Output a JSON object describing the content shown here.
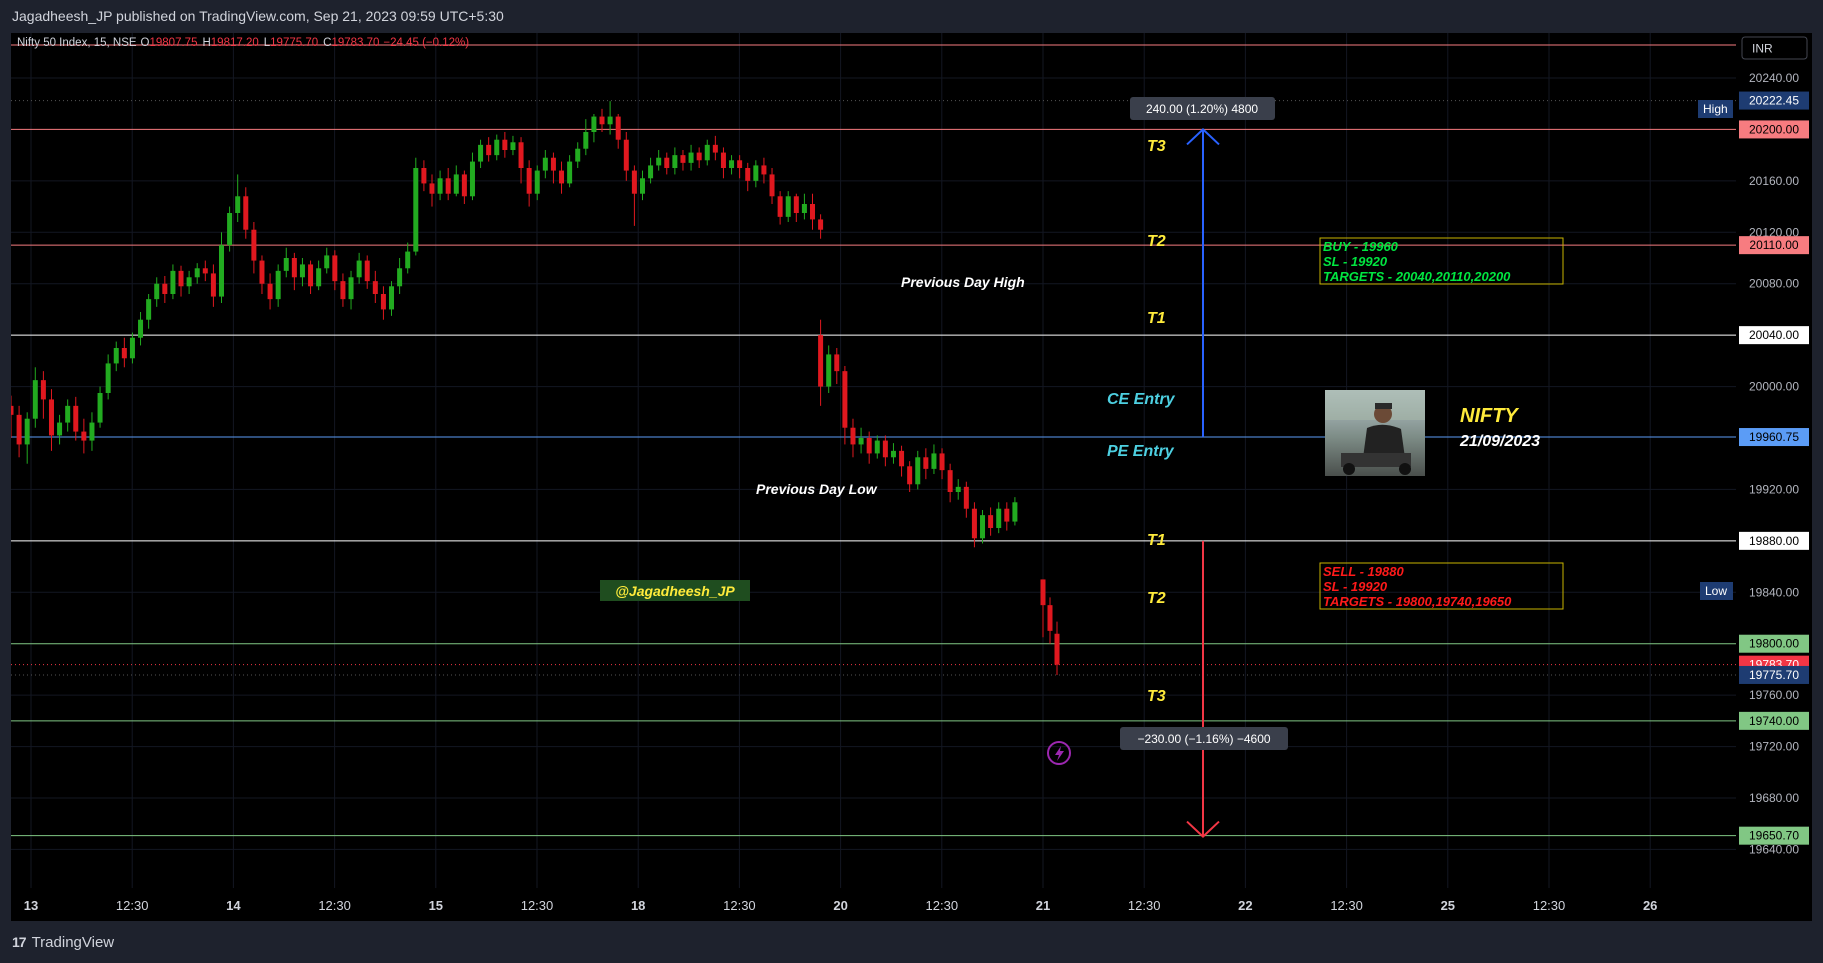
{
  "header": {
    "publish_line": "Jagadheesh_JP published on TradingView.com, Sep 21, 2023 09:59 UTC+5:30"
  },
  "footer": {
    "brand": "TradingView"
  },
  "legend": {
    "symbol": "Nifty 50 Index, 15, NSE",
    "o_label": "O",
    "o_value": "19807.75",
    "h_label": "H",
    "h_value": "19817.20",
    "l_label": "L",
    "l_value": "19775.70",
    "c_label": "C",
    "c_value": "19783.70",
    "change": "−24.45 (−0.12%)"
  },
  "currency": "INR",
  "colors": {
    "up": "#22ab20",
    "down": "#e0181f",
    "background": "#000000",
    "target_label": "#ffeb3b",
    "entry_label": "#4dd0e1"
  },
  "chart_data": {
    "type": "candlestick",
    "title": "Nifty 50 Index, 15, NSE",
    "ylim": [
      19610,
      20275
    ],
    "x_ticks": [
      "13",
      "12:30",
      "14",
      "12:30",
      "15",
      "12:30",
      "18",
      "12:30",
      "20",
      "12:30",
      "21",
      "12:30",
      "22",
      "12:30",
      "25",
      "12:30",
      "26"
    ],
    "y_ticks": [
      "20240.00",
      "20160.00",
      "20120.00",
      "20080.00",
      "20000.00",
      "19920.00",
      "19840.00",
      "19720.00",
      "19680.00",
      "19640.00",
      "19760.00"
    ],
    "levels": [
      {
        "label": "20200.00",
        "value": 20200.0,
        "color": "#f77c80"
      },
      {
        "label": "20110.00",
        "value": 20110.0,
        "color": "#f77c80"
      },
      {
        "label": "20040.00",
        "value": 20040.0,
        "color": "#ffffff"
      },
      {
        "label": "19960.75",
        "value": 19960.75,
        "color": "#5b9cf6"
      },
      {
        "label": "19880.00",
        "value": 19880.0,
        "color": "#ffffff"
      },
      {
        "label": "19800.00",
        "value": 19800.0,
        "color": "#81c784"
      },
      {
        "label": "19740.00",
        "value": 19740.0,
        "color": "#81c784"
      },
      {
        "label": "19650.70",
        "value": 19650.7,
        "color": "#81c784"
      }
    ],
    "high": {
      "label": "High",
      "value": "20222.45"
    },
    "low": {
      "label": "Low",
      "value": "19775.70"
    },
    "last": {
      "value": "19783.70"
    },
    "measures": {
      "up": {
        "text": "240.00 (1.20%) 4800",
        "from": 19960.75,
        "to": 20200.0
      },
      "down": {
        "text": "−230.00 (−1.16%) −4600",
        "from": 19880.0,
        "to": 19650.0
      }
    },
    "sessions": [
      {
        "label": "Sep 13",
        "candles": [
          [
            19985,
            19978,
            19960,
            19993
          ],
          [
            19978,
            19955,
            19945,
            19985
          ],
          [
            19955,
            19975,
            19940,
            19980
          ],
          [
            19975,
            20005,
            19968,
            20015
          ],
          [
            20005,
            19990,
            19975,
            20012
          ],
          [
            19990,
            19962,
            19950,
            19998
          ],
          [
            19962,
            19972,
            19955,
            19978
          ],
          [
            19972,
            19985,
            19965,
            19990
          ],
          [
            19985,
            19965,
            19958,
            19992
          ],
          [
            19965,
            19958,
            19948,
            19975
          ],
          [
            19958,
            19972,
            19950,
            19980
          ],
          [
            19972,
            19995,
            19968,
            20000
          ],
          [
            19995,
            20018,
            19990,
            20025
          ],
          [
            20018,
            20030,
            20012,
            20035
          ],
          [
            20030,
            20022,
            20015,
            20038
          ],
          [
            20022,
            20038,
            20018,
            20042
          ],
          [
            20038,
            20052,
            20032,
            20058
          ],
          [
            20052,
            20068,
            20045,
            20072
          ],
          [
            20068,
            20080,
            20062,
            20085
          ],
          [
            20080,
            20072,
            20065,
            20086
          ],
          [
            20072,
            20090,
            20068,
            20095
          ],
          [
            20090,
            20078,
            20070,
            20094
          ],
          [
            20078,
            20085,
            20072,
            20090
          ],
          [
            20085,
            20092,
            20080,
            20096
          ],
          [
            20092,
            20088,
            20082,
            20098
          ]
        ]
      },
      {
        "label": "Sep 14",
        "candles": [
          [
            20088,
            20070,
            20062,
            20095
          ],
          [
            20070,
            20110,
            20065,
            20120
          ],
          [
            20110,
            20135,
            20105,
            20140
          ],
          [
            20135,
            20148,
            20128,
            20165
          ],
          [
            20148,
            20122,
            20115,
            20155
          ],
          [
            20122,
            20098,
            20088,
            20128
          ],
          [
            20098,
            20080,
            20072,
            20102
          ],
          [
            20080,
            20068,
            20060,
            20088
          ],
          [
            20068,
            20090,
            20062,
            20095
          ],
          [
            20090,
            20100,
            20085,
            20108
          ],
          [
            20100,
            20085,
            20075,
            20104
          ],
          [
            20085,
            20095,
            20078,
            20100
          ],
          [
            20095,
            20078,
            20072,
            20098
          ],
          [
            20078,
            20092,
            20075,
            20098
          ],
          [
            20092,
            20102,
            20088,
            20108
          ],
          [
            20102,
            20082,
            20075,
            20106
          ],
          [
            20082,
            20068,
            20062,
            20088
          ],
          [
            20068,
            20085,
            20060,
            20090
          ],
          [
            20085,
            20098,
            20080,
            20104
          ],
          [
            20098,
            20082,
            20076,
            20102
          ],
          [
            20082,
            20072,
            20065,
            20090
          ],
          [
            20072,
            20060,
            20052,
            20078
          ],
          [
            20060,
            20078,
            20055,
            20082
          ],
          [
            20078,
            20092,
            20072,
            20100
          ],
          [
            20092,
            20105,
            20088,
            20112
          ]
        ]
      },
      {
        "label": "Sep 15",
        "candles": [
          [
            20105,
            20170,
            20102,
            20178
          ],
          [
            20170,
            20158,
            20152,
            20176
          ],
          [
            20158,
            20150,
            20140,
            20165
          ],
          [
            20150,
            20162,
            20145,
            20168
          ],
          [
            20162,
            20150,
            20145,
            20170
          ],
          [
            20150,
            20165,
            20148,
            20172
          ],
          [
            20165,
            20148,
            20142,
            20168
          ],
          [
            20148,
            20175,
            20145,
            20182
          ],
          [
            20175,
            20188,
            20170,
            20192
          ],
          [
            20188,
            20180,
            20175,
            20194
          ],
          [
            20180,
            20192,
            20176,
            20196
          ],
          [
            20192,
            20184,
            20178,
            20198
          ],
          [
            20184,
            20190,
            20180,
            20195
          ],
          [
            20190,
            20170,
            20158,
            20194
          ],
          [
            20170,
            20150,
            20140,
            20176
          ],
          [
            20150,
            20168,
            20145,
            20172
          ],
          [
            20168,
            20178,
            20162,
            20184
          ],
          [
            20178,
            20168,
            20158,
            20182
          ],
          [
            20168,
            20158,
            20150,
            20175
          ],
          [
            20158,
            20175,
            20155,
            20180
          ],
          [
            20175,
            20185,
            20170,
            20190
          ],
          [
            20185,
            20198,
            20180,
            20208
          ],
          [
            20198,
            20210,
            20190,
            20212
          ],
          [
            20210,
            20204,
            20198,
            20216
          ],
          [
            20204,
            20210,
            20196,
            20222
          ]
        ]
      },
      {
        "label": "Sep 18",
        "candles": [
          [
            20210,
            20192,
            20185,
            20212
          ],
          [
            20192,
            20168,
            20160,
            20198
          ],
          [
            20168,
            20150,
            20125,
            20172
          ],
          [
            20150,
            20162,
            20145,
            20168
          ],
          [
            20162,
            20172,
            20158,
            20178
          ],
          [
            20172,
            20178,
            20168,
            20184
          ],
          [
            20178,
            20170,
            20165,
            20182
          ],
          [
            20170,
            20180,
            20165,
            20186
          ],
          [
            20180,
            20174,
            20168,
            20184
          ],
          [
            20174,
            20182,
            20168,
            20188
          ],
          [
            20182,
            20176,
            20170,
            20186
          ],
          [
            20176,
            20188,
            20172,
            20192
          ],
          [
            20188,
            20182,
            20176,
            20195
          ],
          [
            20182,
            20170,
            20162,
            20186
          ],
          [
            20170,
            20176,
            20165,
            20180
          ],
          [
            20176,
            20170,
            20162,
            20180
          ],
          [
            20170,
            20160,
            20152,
            20174
          ],
          [
            20160,
            20172,
            20155,
            20176
          ],
          [
            20172,
            20165,
            20158,
            20178
          ],
          [
            20165,
            20148,
            20142,
            20170
          ],
          [
            20148,
            20132,
            20126,
            20152
          ],
          [
            20132,
            20148,
            20128,
            20152
          ],
          [
            20148,
            20135,
            20128,
            20150
          ],
          [
            20135,
            20142,
            20130,
            20150
          ],
          [
            20142,
            20130,
            20122,
            20150
          ],
          [
            20130,
            20122,
            20115,
            20134
          ]
        ]
      },
      {
        "label": "Sep 20",
        "candles": [
          [
            20040,
            20000,
            19985,
            20052
          ],
          [
            20000,
            20025,
            19995,
            20032
          ],
          [
            20025,
            20012,
            20002,
            20030
          ],
          [
            20012,
            19968,
            19955,
            20016
          ],
          [
            19968,
            19955,
            19945,
            19975
          ],
          [
            19955,
            19960,
            19948,
            19968
          ],
          [
            19960,
            19948,
            19940,
            19965
          ],
          [
            19948,
            19958,
            19944,
            19962
          ],
          [
            19958,
            19945,
            19938,
            19962
          ],
          [
            19945,
            19950,
            19940,
            19956
          ],
          [
            19950,
            19938,
            19930,
            19954
          ],
          [
            19938,
            19924,
            19918,
            19942
          ],
          [
            19924,
            19945,
            19920,
            19950
          ],
          [
            19945,
            19936,
            19928,
            19952
          ],
          [
            19936,
            19948,
            19932,
            19955
          ],
          [
            19948,
            19935,
            19928,
            19952
          ],
          [
            19935,
            19918,
            19910,
            19940
          ],
          [
            19918,
            19922,
            19912,
            19928
          ],
          [
            19922,
            19905,
            19898,
            19926
          ],
          [
            19905,
            19882,
            19875,
            19910
          ],
          [
            19882,
            19900,
            19878,
            19904
          ],
          [
            19900,
            19890,
            19884,
            19906
          ],
          [
            19890,
            19905,
            19886,
            19910
          ],
          [
            19905,
            19895,
            19888,
            19910
          ],
          [
            19895,
            19910,
            19892,
            19914
          ]
        ]
      },
      {
        "label": "Sep 21",
        "candles": [
          [
            19850,
            19830,
            19805,
            19850
          ],
          [
            19830,
            19810,
            19800,
            19836
          ],
          [
            19807.75,
            19783.7,
            19775.7,
            19817.2
          ]
        ]
      }
    ]
  },
  "annotations": {
    "t3_top": "T3",
    "t2_top": "T2",
    "t1_top": "T1",
    "prev_day_high": "Previous Day High",
    "ce_entry": "CE Entry",
    "pe_entry": "PE Entry",
    "prev_day_low": "Previous Day Low",
    "t1_bottom": "T1",
    "t2_bottom": "T2",
    "t3_bottom": "T3",
    "handle": "@Jagadheesh_JP",
    "nifty": "NIFTY",
    "date": "21/09/2023",
    "buy_lines": [
      "BUY - 19960",
      "SL - 19920",
      "TARGETS - 20040,20110,20200"
    ],
    "sell_lines": [
      "SELL - 19880",
      "SL - 19920",
      "TARGETS - 19800,19740,19650"
    ]
  }
}
